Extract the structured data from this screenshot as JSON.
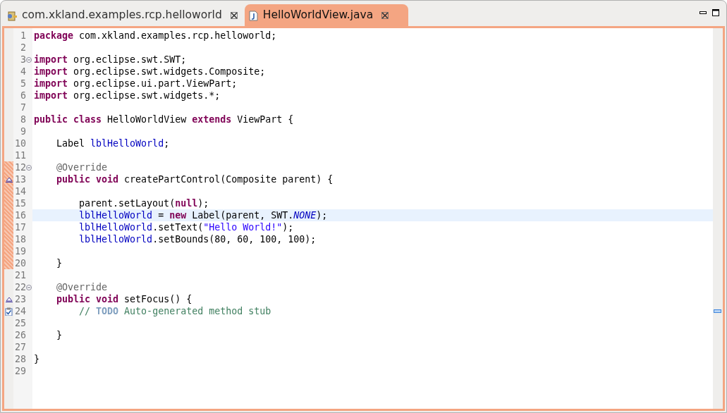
{
  "tabs": [
    {
      "label": "com.xkland.examples.rcp.helloworld",
      "kind": "package",
      "selected": false
    },
    {
      "label": "HelloWorldView.java",
      "kind": "java",
      "selected": true
    }
  ],
  "editor": {
    "lines": [
      {
        "number": "1",
        "kind": "code",
        "fold": false,
        "changed": false,
        "current": false,
        "tokens": [
          {
            "kind": "keyword",
            "text": "package"
          },
          {
            "kind": "plain",
            "text": " com.xkland.examples.rcp.helloworld;"
          }
        ]
      },
      {
        "number": "2",
        "kind": "code",
        "fold": false,
        "changed": false,
        "current": false
      },
      {
        "number": "3",
        "kind": "code",
        "fold": true,
        "changed": false,
        "current": false,
        "tokens": [
          {
            "kind": "keyword",
            "text": "import"
          },
          {
            "kind": "plain",
            "text": " org.eclipse.swt.SWT;"
          }
        ]
      },
      {
        "number": "4",
        "kind": "code",
        "fold": false,
        "changed": false,
        "current": false,
        "tokens": [
          {
            "kind": "keyword",
            "text": "import"
          },
          {
            "kind": "plain",
            "text": " org.eclipse.swt.widgets.Composite;"
          }
        ]
      },
      {
        "number": "5",
        "kind": "code",
        "fold": false,
        "changed": false,
        "current": false,
        "tokens": [
          {
            "kind": "keyword",
            "text": "import"
          },
          {
            "kind": "plain",
            "text": " org.eclipse.ui.part.ViewPart;"
          }
        ]
      },
      {
        "number": "6",
        "kind": "code",
        "fold": false,
        "changed": false,
        "current": false,
        "tokens": [
          {
            "kind": "keyword",
            "text": "import"
          },
          {
            "kind": "plain",
            "text": " org.eclipse.swt.widgets.*;"
          }
        ]
      },
      {
        "number": "7",
        "kind": "code",
        "fold": false,
        "changed": false,
        "current": false
      },
      {
        "number": "8",
        "kind": "code",
        "fold": false,
        "changed": false,
        "current": false,
        "tokens": [
          {
            "kind": "keyword",
            "text": "public class"
          },
          {
            "kind": "plain",
            "text": " HelloWorldView "
          },
          {
            "kind": "keyword",
            "text": "extends"
          },
          {
            "kind": "plain",
            "text": " ViewPart {"
          }
        ]
      },
      {
        "number": "9",
        "kind": "code",
        "fold": false,
        "changed": false,
        "current": false
      },
      {
        "number": "10",
        "kind": "code",
        "fold": false,
        "changed": false,
        "current": false,
        "tokens": [
          {
            "kind": "plain",
            "text": "    Label "
          },
          {
            "kind": "field",
            "text": "lblHelloWorld"
          },
          {
            "kind": "plain",
            "text": ";"
          }
        ]
      },
      {
        "number": "11",
        "kind": "code",
        "fold": false,
        "changed": false,
        "current": false
      },
      {
        "number": "12",
        "kind": "code",
        "fold": true,
        "changed": true,
        "current": false,
        "tokens": [
          {
            "kind": "annotation",
            "text": "    @Override"
          }
        ]
      },
      {
        "number": "13",
        "kind": "override",
        "fold": false,
        "changed": true,
        "current": false,
        "tokens": [
          {
            "kind": "keyword",
            "text": "    public void"
          },
          {
            "kind": "plain",
            "text": " createPartControl(Composite parent) {"
          }
        ]
      },
      {
        "number": "14",
        "kind": "code",
        "fold": false,
        "changed": true,
        "current": false
      },
      {
        "number": "15",
        "kind": "code",
        "fold": false,
        "changed": true,
        "current": false,
        "tokens": [
          {
            "kind": "plain",
            "text": "        parent.setLayout("
          },
          {
            "kind": "keyword",
            "text": "null"
          },
          {
            "kind": "plain",
            "text": ");"
          }
        ]
      },
      {
        "number": "16",
        "kind": "code",
        "fold": false,
        "changed": true,
        "current": true,
        "tokens": [
          {
            "kind": "field",
            "text": "        lblHelloWorld"
          },
          {
            "kind": "plain",
            "text": " = "
          },
          {
            "kind": "keyword",
            "text": "new"
          },
          {
            "kind": "plain",
            "text": " Label(parent, SWT."
          },
          {
            "kind": "constant",
            "text": "NONE"
          },
          {
            "kind": "plain",
            "text": ");"
          }
        ]
      },
      {
        "number": "17",
        "kind": "code",
        "fold": false,
        "changed": true,
        "current": false,
        "tokens": [
          {
            "kind": "field",
            "text": "        lblHelloWorld"
          },
          {
            "kind": "plain",
            "text": ".setText("
          },
          {
            "kind": "string",
            "text": "\"Hello World!\""
          },
          {
            "kind": "plain",
            "text": ");"
          }
        ]
      },
      {
        "number": "18",
        "kind": "code",
        "fold": false,
        "changed": true,
        "current": false,
        "tokens": [
          {
            "kind": "field",
            "text": "        lblHelloWorld"
          },
          {
            "kind": "plain",
            "text": ".setBounds(80, 60, 100, 100);"
          }
        ]
      },
      {
        "number": "19",
        "kind": "code",
        "fold": false,
        "changed": true,
        "current": false
      },
      {
        "number": "20",
        "kind": "code",
        "fold": false,
        "changed": true,
        "current": false,
        "tokens": [
          {
            "kind": "plain",
            "text": "    }"
          }
        ]
      },
      {
        "number": "21",
        "kind": "code",
        "fold": false,
        "changed": false,
        "current": false
      },
      {
        "number": "22",
        "kind": "code",
        "fold": true,
        "changed": false,
        "current": false,
        "tokens": [
          {
            "kind": "annotation",
            "text": "    @Override"
          }
        ]
      },
      {
        "number": "23",
        "kind": "override",
        "fold": false,
        "changed": false,
        "current": false,
        "tokens": [
          {
            "kind": "keyword",
            "text": "    public void"
          },
          {
            "kind": "plain",
            "text": " setFocus() {"
          }
        ]
      },
      {
        "number": "24",
        "kind": "task",
        "fold": false,
        "changed": false,
        "current": false,
        "tokens": [
          {
            "kind": "comment",
            "text": "        // "
          },
          {
            "kind": "todo",
            "text": "TODO"
          },
          {
            "kind": "comment",
            "text": " Auto-generated method stub"
          }
        ]
      },
      {
        "number": "25",
        "kind": "code",
        "fold": false,
        "changed": false,
        "current": false
      },
      {
        "number": "26",
        "kind": "code",
        "fold": false,
        "changed": false,
        "current": false,
        "tokens": [
          {
            "kind": "plain",
            "text": "    }"
          }
        ]
      },
      {
        "number": "27",
        "kind": "code",
        "fold": false,
        "changed": false,
        "current": false
      },
      {
        "number": "28",
        "kind": "code",
        "fold": false,
        "changed": false,
        "current": false,
        "tokens": [
          {
            "kind": "plain",
            "text": "}"
          }
        ]
      },
      {
        "number": "29",
        "kind": "code",
        "fold": false,
        "changed": false,
        "current": false
      }
    ]
  }
}
